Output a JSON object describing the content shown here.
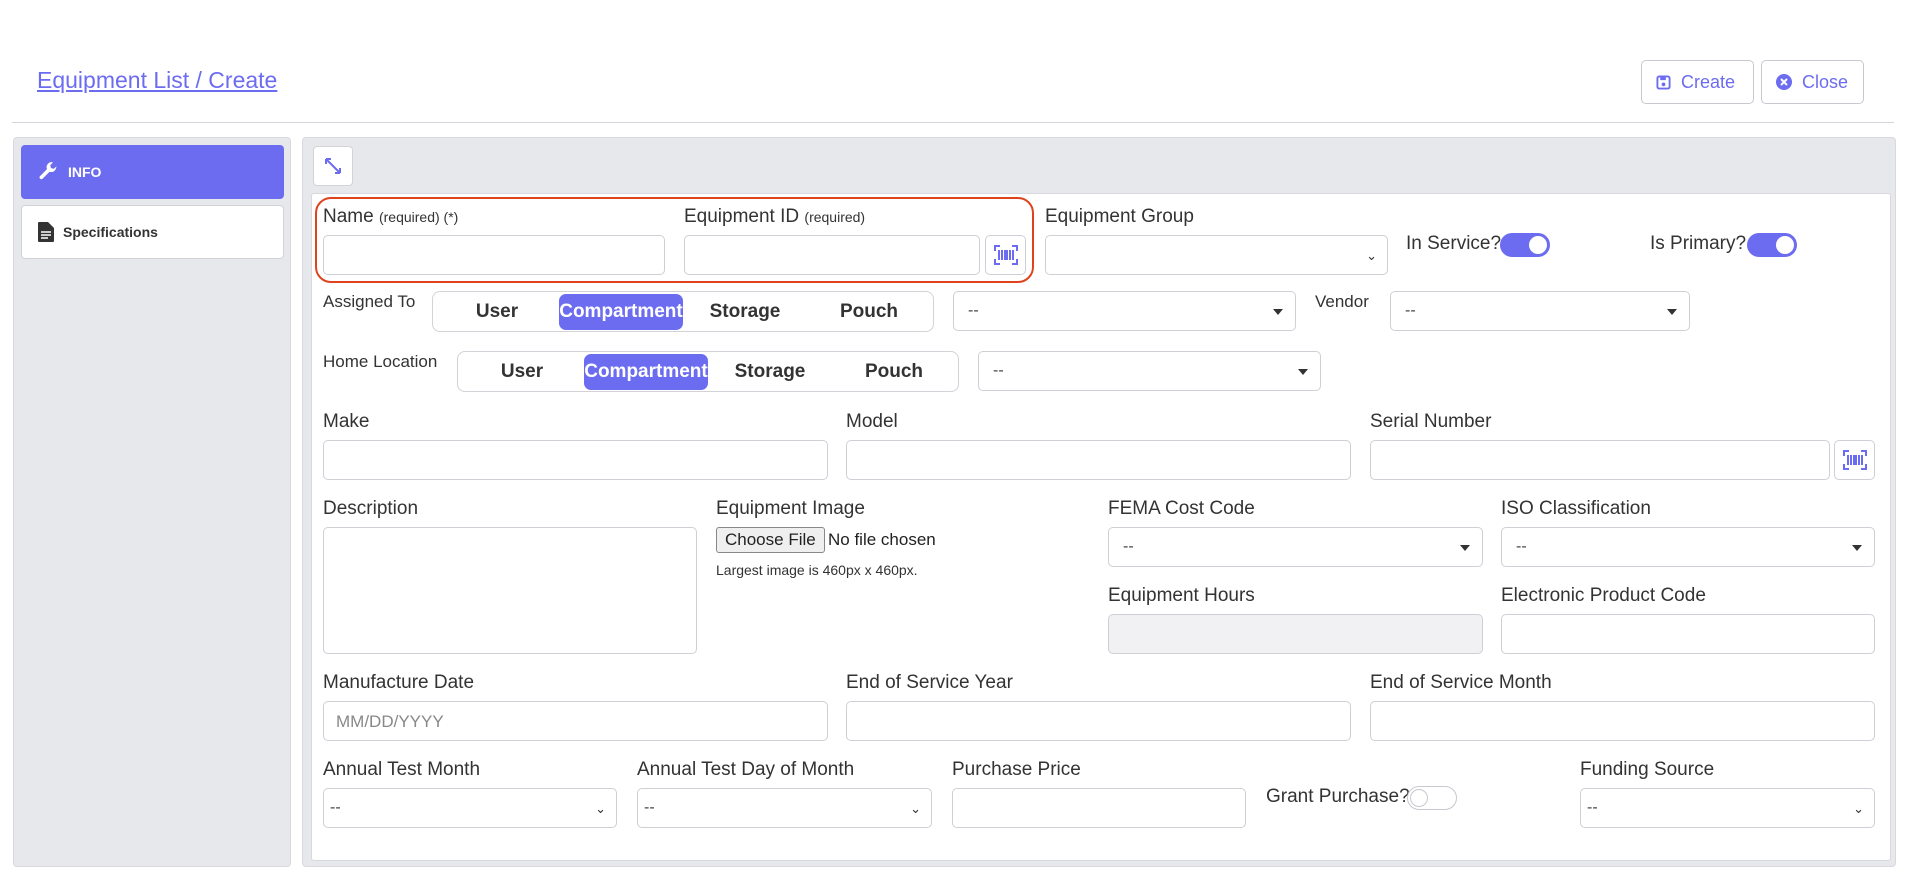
{
  "header": {
    "title": "Equipment List / Create",
    "create_label": "Create",
    "close_label": "Close"
  },
  "sidebar": {
    "items": [
      {
        "label": "INFO",
        "active": true
      },
      {
        "label": "Specifications",
        "active": false
      }
    ]
  },
  "form": {
    "name": {
      "label": "Name",
      "note": "(required) (*)",
      "value": ""
    },
    "equipment_id": {
      "label": "Equipment ID",
      "note": "(required)",
      "value": ""
    },
    "equipment_group": {
      "label": "Equipment Group",
      "value": ""
    },
    "in_service": {
      "label": "In Service?",
      "on": true
    },
    "is_primary": {
      "label": "Is Primary?",
      "on": true
    },
    "assigned_to": {
      "label": "Assigned To",
      "options": [
        "User",
        "Compartment",
        "Storage",
        "Pouch"
      ],
      "selected": "Compartment",
      "select_value": "--"
    },
    "vendor": {
      "label": "Vendor",
      "value": "--"
    },
    "home_location": {
      "label": "Home Location",
      "options": [
        "User",
        "Compartment",
        "Storage",
        "Pouch"
      ],
      "selected": "Compartment",
      "select_value": "--"
    },
    "make": {
      "label": "Make",
      "value": ""
    },
    "model": {
      "label": "Model",
      "value": ""
    },
    "serial_number": {
      "label": "Serial Number",
      "value": ""
    },
    "description": {
      "label": "Description",
      "value": ""
    },
    "equipment_image": {
      "label": "Equipment Image",
      "button": "Choose File",
      "status": "No file chosen",
      "hint": "Largest image is 460px x 460px."
    },
    "fema_cost_code": {
      "label": "FEMA Cost Code",
      "value": "--"
    },
    "iso_classification": {
      "label": "ISO Classification",
      "value": "--"
    },
    "equipment_hours": {
      "label": "Equipment Hours",
      "value": ""
    },
    "electronic_product_code": {
      "label": "Electronic Product Code",
      "value": ""
    },
    "manufacture_date": {
      "label": "Manufacture Date",
      "placeholder": "MM/DD/YYYY"
    },
    "end_of_service_year": {
      "label": "End of Service Year",
      "value": ""
    },
    "end_of_service_month": {
      "label": "End of Service Month",
      "value": ""
    },
    "annual_test_month": {
      "label": "Annual Test Month",
      "value": "--"
    },
    "annual_test_day": {
      "label": "Annual Test Day of Month",
      "value": "--"
    },
    "purchase_price": {
      "label": "Purchase Price",
      "value": ""
    },
    "grant_purchase": {
      "label": "Grant Purchase?",
      "on": false
    },
    "funding_source": {
      "label": "Funding Source",
      "value": "--"
    }
  },
  "colors": {
    "accent": "#6c6cf0",
    "highlight": "#e0421d"
  }
}
